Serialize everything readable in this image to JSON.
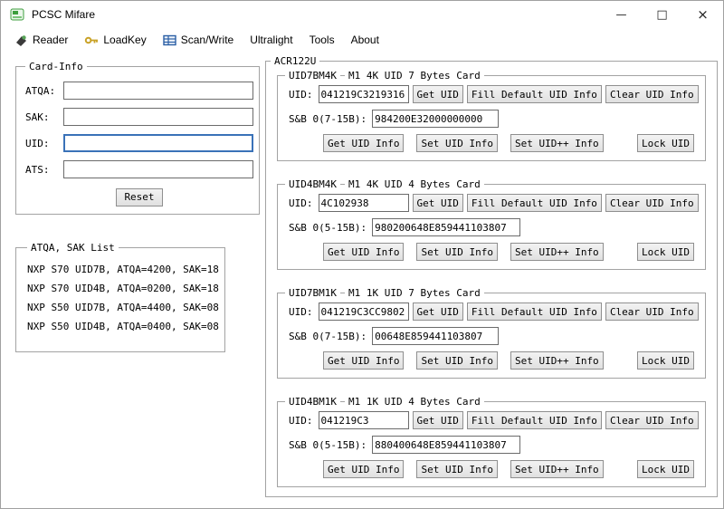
{
  "window": {
    "title": "PCSC Mifare",
    "minimize": "—",
    "maximize": "□",
    "close": "×"
  },
  "menu": {
    "reader": "Reader",
    "loadkey": "LoadKey",
    "scanwrite": "Scan/Write",
    "ultralight": "Ultralight",
    "tools": "Tools",
    "about": "About"
  },
  "card_info": {
    "title": "Card-Info",
    "atqa_label": "ATQA:",
    "atqa_value": "",
    "sak_label": "SAK:",
    "sak_value": "",
    "uid_label": "UID:",
    "uid_value": "",
    "ats_label": "ATS:",
    "ats_value": "",
    "reset_label": "Reset"
  },
  "atqa_sak_list": {
    "title": "ATQA, SAK List",
    "items": [
      "NXP S70 UID7B, ATQA=4200, SAK=18",
      "NXP S70 UID4B, ATQA=0200, SAK=18",
      "NXP S50 UID7B, ATQA=4400, SAK=08",
      "NXP S50 UID4B, ATQA=0400, SAK=08"
    ]
  },
  "acr122u": {
    "title": "ACR122U",
    "uid_label": "UID:",
    "buttons": {
      "get_uid": "Get UID",
      "fill_default_uid_info": "Fill Default UID Info",
      "clear_uid_info": "Clear UID Info",
      "get_uid_info": "Get UID Info",
      "set_uid_info": "Set UID Info",
      "set_uid_pp_info": "Set UID++ Info",
      "lock_uid": "Lock UID"
    },
    "groups": [
      {
        "name": "UID7BM4K",
        "card_type": "M1 4K UID 7 Bytes Card",
        "uid_value": "041219C3219316",
        "sb_label": "S&B 0(7-15B):",
        "sb_value": "984200E32000000000"
      },
      {
        "name": "UID4BM4K",
        "card_type": "M1 4K UID 4 Bytes Card",
        "uid_value": "4C102938",
        "sb_label": "S&B 0(5-15B):",
        "sb_value": "980200648E859441103807"
      },
      {
        "name": "UID7BM1K",
        "card_type": "M1 1K UID 7 Bytes Card",
        "uid_value": "041219C3CC9802",
        "sb_label": "S&B 0(7-15B):",
        "sb_value": "00648E859441103807"
      },
      {
        "name": "UID4BM1K",
        "card_type": "M1 1K UID 4 Bytes Card",
        "uid_value": "041219C3",
        "sb_label": "S&B 0(5-15B):",
        "sb_value": "880400648E859441103807"
      }
    ]
  }
}
